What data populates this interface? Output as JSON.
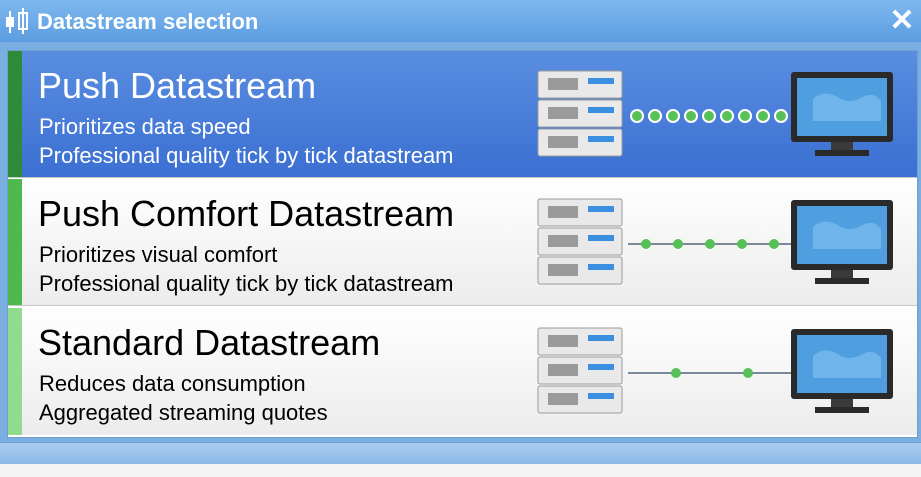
{
  "window": {
    "title": "Datastream selection"
  },
  "colors": {
    "titlebar": "#5b9de0",
    "selected_bg": "#4a7fdb",
    "stripe_1": "#2e8b3a",
    "stripe_2": "#4fb84f",
    "stripe_3": "#8fdc8f",
    "link_dot": "#57c157"
  },
  "options": [
    {
      "title": "Push Datastream",
      "line1": "Prioritizes data speed",
      "line2": "Professional quality tick by tick datastream",
      "selected": true
    },
    {
      "title": "Push Comfort Datastream",
      "line1": "Prioritizes visual comfort",
      "line2": "Professional quality tick by tick datastream",
      "selected": false
    },
    {
      "title": "Standard Datastream",
      "line1": "Reduces data consumption",
      "line2": "Aggregated streaming quotes",
      "selected": false
    }
  ]
}
